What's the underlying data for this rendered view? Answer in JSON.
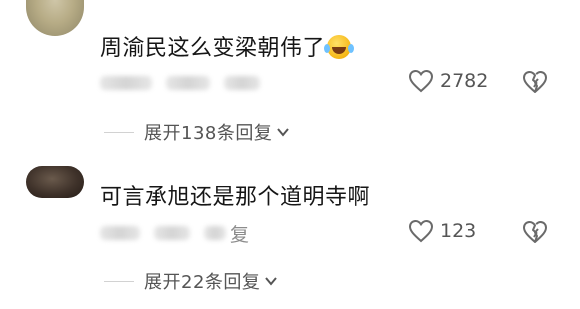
{
  "comments": [
    {
      "text": "周渝民这么变梁朝伟了",
      "emoji": "rolling-laughing-emoji",
      "likes": "2782",
      "expand_label": "展开138条回复"
    },
    {
      "text": "可言承旭还是那个道明寺啊",
      "reply_label": "复",
      "likes": "123",
      "expand_label": "展开22条回复"
    }
  ]
}
